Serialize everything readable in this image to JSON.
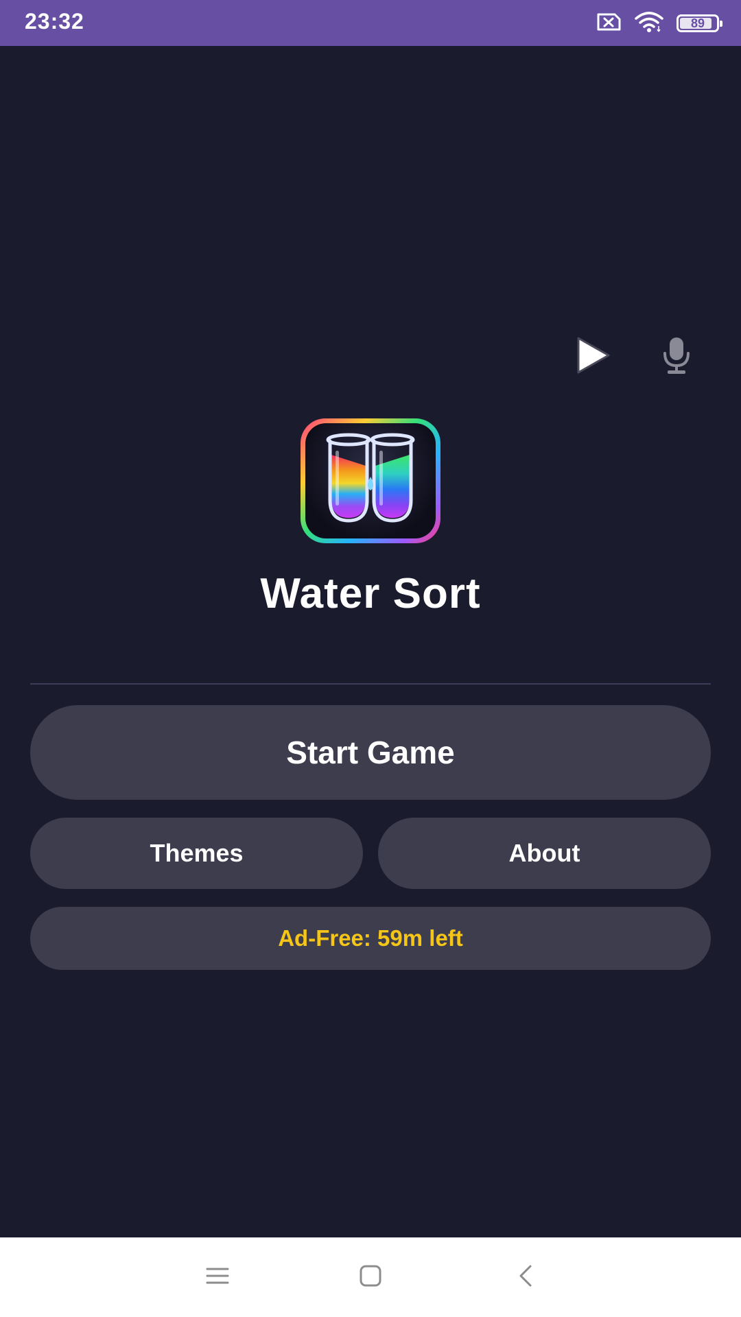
{
  "status_bar": {
    "time": "23:32",
    "battery_level": "89",
    "icons": [
      "no-sim-icon",
      "wifi-icon",
      "battery-icon"
    ],
    "background_color": "#6750a4"
  },
  "controls": {
    "play_icon": "play-icon",
    "mic_icon": "microphone-icon"
  },
  "app": {
    "title": "Water Sort",
    "icon": "water-sort-app-icon"
  },
  "menu": {
    "start_label": "Start Game",
    "themes_label": "Themes",
    "about_label": "About",
    "adfree_label": "Ad-Free: 59m left",
    "adfree_color": "#f5c518",
    "button_color": "#3e3d4e",
    "background_color": "#1b1b2e"
  },
  "nav_bar": {
    "icons": [
      "menu-icon",
      "home-icon",
      "back-icon"
    ]
  }
}
